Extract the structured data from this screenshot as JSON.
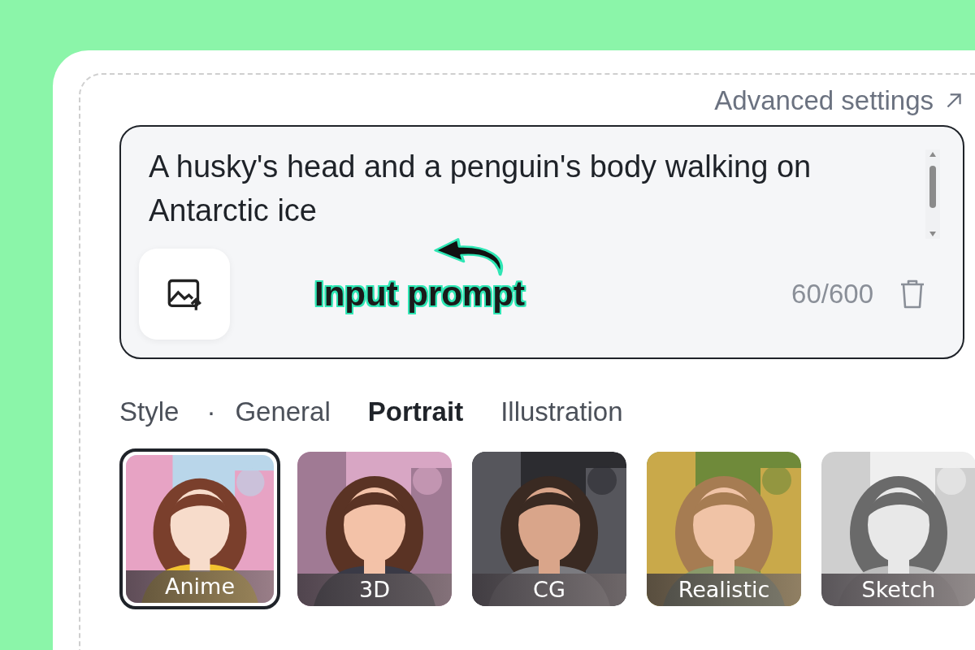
{
  "header": {
    "link": "Advanced settings"
  },
  "prompt": {
    "value": "A husky's head and a penguin's body walking on Antarctic ice",
    "counter": "60/600"
  },
  "annotation": {
    "label": "Input prompt"
  },
  "style": {
    "label": "Style",
    "separator": "·",
    "tabs": [
      {
        "label": "General",
        "selected": false
      },
      {
        "label": "Portrait",
        "selected": true
      },
      {
        "label": "Illustration",
        "selected": false
      }
    ]
  },
  "options": [
    {
      "label": "Anime",
      "selected": true
    },
    {
      "label": "3D",
      "selected": false
    },
    {
      "label": "CG",
      "selected": false
    },
    {
      "label": "Realistic",
      "selected": false
    },
    {
      "label": "Sketch",
      "selected": false
    }
  ]
}
